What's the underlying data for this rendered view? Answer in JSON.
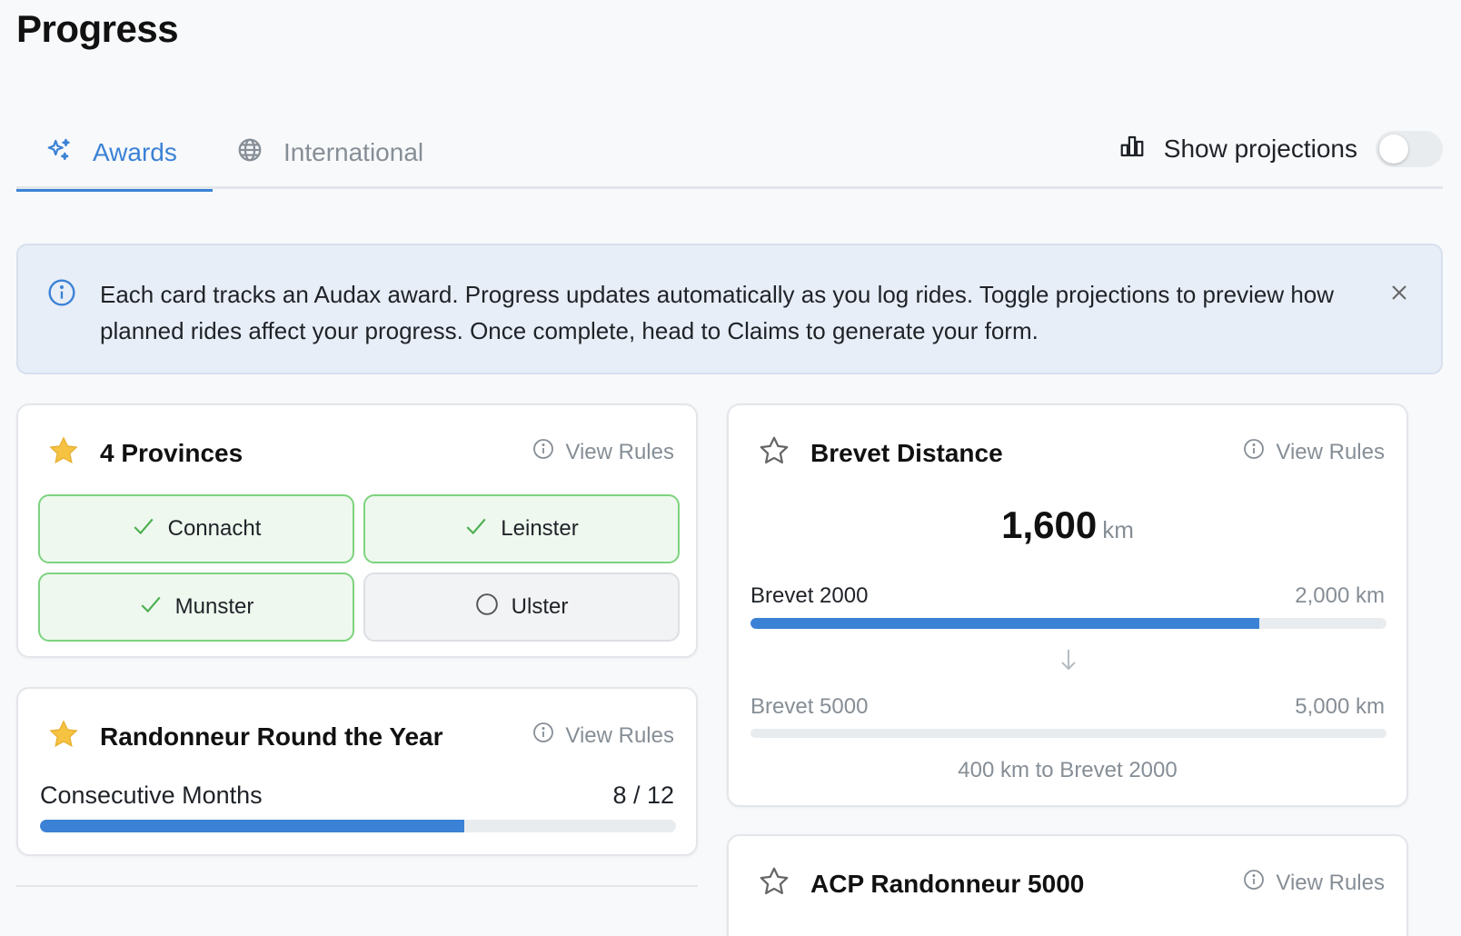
{
  "page": {
    "title": "Progress"
  },
  "tabs": [
    {
      "label": "Awards",
      "icon": "sparkles-icon",
      "active": true
    },
    {
      "label": "International",
      "icon": "globe-icon",
      "active": false
    }
  ],
  "projections": {
    "label": "Show projections",
    "icon": "bar-chart-icon",
    "enabled": false
  },
  "alert": {
    "icon": "info-icon",
    "text": "Each card tracks an Audax award. Progress updates automatically as you log rides. Toggle projections to preview how planned rides affect your progress. Once complete, head to Claims to generate your form."
  },
  "cards": {
    "provinces": {
      "title": "4 Provinces",
      "view_rules": "View Rules",
      "starred": true,
      "items": [
        {
          "label": "Connacht",
          "done": true
        },
        {
          "label": "Leinster",
          "done": true
        },
        {
          "label": "Munster",
          "done": true
        },
        {
          "label": "Ulster",
          "done": false
        }
      ]
    },
    "rrty": {
      "title": "Randonneur Round the Year",
      "view_rules": "View Rules",
      "starred": true,
      "row_label": "Consecutive Months",
      "progress_text": "8 / 12",
      "current": 8,
      "target": 12
    },
    "brevet": {
      "title": "Brevet Distance",
      "view_rules": "View Rules",
      "starred": false,
      "value": "1,600",
      "unit": "km",
      "current_km": 1600,
      "tiers": [
        {
          "name": "Brevet 2000",
          "target_label": "2,000 km",
          "target": 2000,
          "fill": 0.8
        },
        {
          "name": "Brevet 5000",
          "target_label": "5,000 km",
          "target": 5000,
          "fill": 0
        }
      ],
      "remaining": "400 km to Brevet 2000"
    },
    "acp": {
      "title": "ACP Randonneur 5000",
      "view_rules": "View Rules",
      "starred": false
    }
  },
  "colors": {
    "accent": "#3b82d6",
    "success": "#4caf50",
    "star": "#f5c242",
    "muted": "#868e96"
  }
}
